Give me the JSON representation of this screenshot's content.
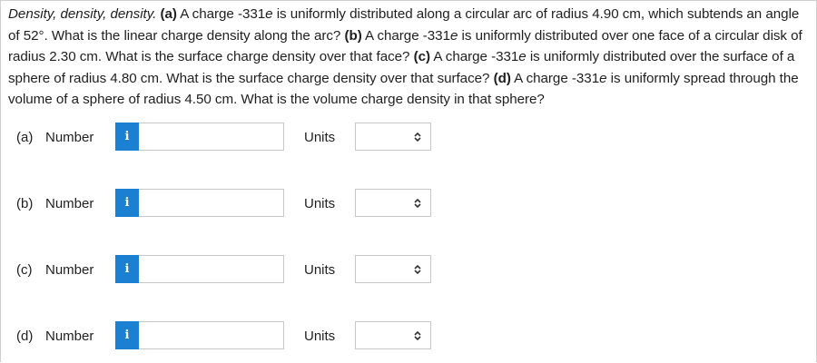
{
  "question": {
    "lead": "Density, density, density.",
    "part_a_tag": "(a)",
    "part_a_text_1": " A charge -331",
    "part_a_unit": "e",
    "part_a_text_2": " is uniformly distributed along a circular arc of radius 4.90 cm, which subtends an angle of 52°. What is the linear charge density along the arc? ",
    "part_b_tag": "(b)",
    "part_b_text_1": " A charge -331",
    "part_b_unit": "e",
    "part_b_text_2": " is uniformly distributed over one face of a circular disk of radius 2.30 cm. What is the surface charge density over that face? ",
    "part_c_tag": "(c)",
    "part_c_text_1": " A charge -331",
    "part_c_unit": "e",
    "part_c_text_2": " is uniformly distributed over the surface of a sphere of radius 4.80 cm. What is the surface charge density over that surface? ",
    "part_d_tag": "(d)",
    "part_d_text_1": " A charge -331",
    "part_d_unit": "e",
    "part_d_text_2": " is uniformly spread through the volume of a sphere of radius 4.50 cm. What is the volume charge density in that sphere?"
  },
  "answers": [
    {
      "part": "(a)",
      "number_label": "Number",
      "info_icon": "i",
      "value": "",
      "units_label": "Units",
      "units_value": ""
    },
    {
      "part": "(b)",
      "number_label": "Number",
      "info_icon": "i",
      "value": "",
      "units_label": "Units",
      "units_value": ""
    },
    {
      "part": "(c)",
      "number_label": "Number",
      "info_icon": "i",
      "value": "",
      "units_label": "Units",
      "units_value": ""
    },
    {
      "part": "(d)",
      "number_label": "Number",
      "info_icon": "i",
      "value": "",
      "units_label": "Units",
      "units_value": ""
    }
  ],
  "colors": {
    "info_button": "#1b80d2",
    "border": "#c8c8c8",
    "text": "#1f1f1f"
  },
  "icons": {
    "info": "info-icon",
    "dropdown": "chevron-up-down-icon"
  }
}
